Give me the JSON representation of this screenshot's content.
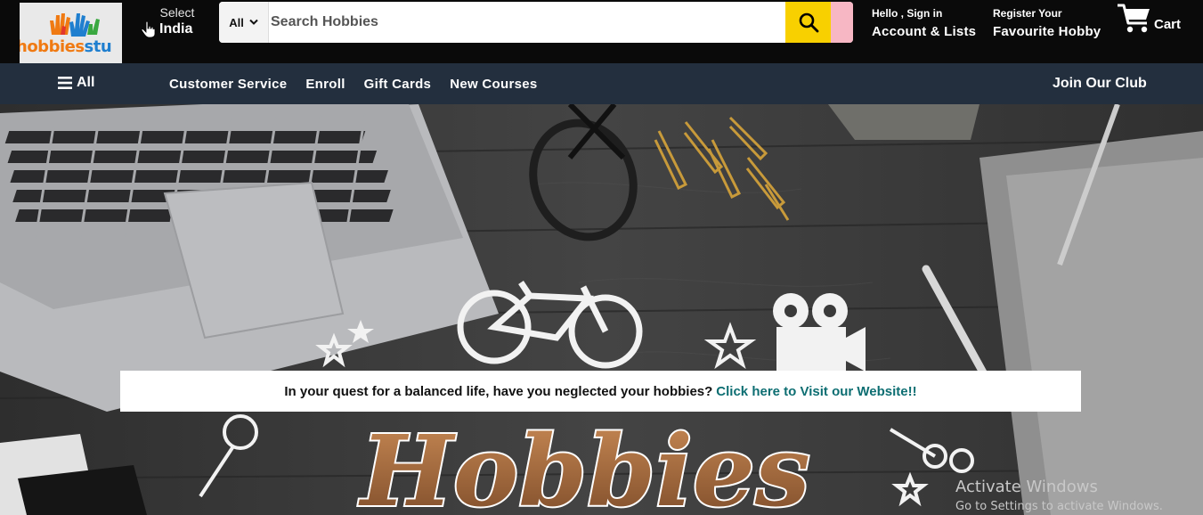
{
  "logo": {
    "text_orange": "hobbies",
    "text_blue": "stu"
  },
  "location": {
    "label": "Select",
    "value": "India"
  },
  "search": {
    "category": "All",
    "placeholder": "Search Hobbies"
  },
  "account": {
    "greeting": "Hello , Sign in",
    "label": "Account & Lists"
  },
  "register": {
    "line1": "Register Your",
    "line2": "Favourite Hobby"
  },
  "cart": {
    "label": "Cart"
  },
  "nav": {
    "all_label": "All",
    "links": [
      "Customer Service",
      "Enroll",
      "Gift Cards",
      "New Courses"
    ],
    "club_label": "Join Our Club"
  },
  "hero": {
    "title": "Hobbies"
  },
  "promo": {
    "text": "In your quest for a balanced life, have you neglected your hobbies?",
    "link": "Click here to Visit our Website!!"
  },
  "watermark": {
    "line1": "Activate Windows",
    "line2": "Go to Settings to activate Windows."
  },
  "colors": {
    "header_bg": "#0a0a0a",
    "nav_bg": "#232f3e",
    "search_button": "#f8d000",
    "link_teal": "#0d6e72"
  },
  "icons": [
    "hand-pointer-icon",
    "chevron-down-icon",
    "search-icon",
    "cart-icon",
    "hamburger-icon"
  ]
}
